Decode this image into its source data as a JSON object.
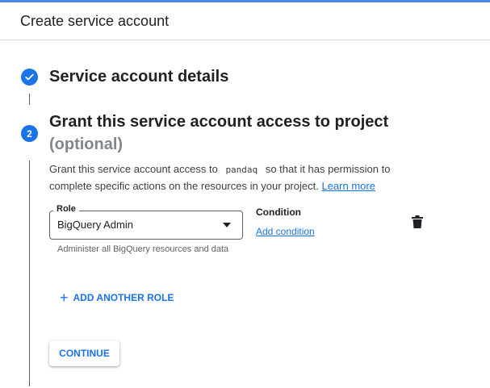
{
  "header": {
    "title": "Create service account"
  },
  "steps": [
    {
      "status": "completed",
      "title": "Service account details"
    },
    {
      "number": "2",
      "title": "Grant this service account access to project",
      "subtitle": "(optional)"
    }
  ],
  "grant": {
    "desc_prefix": "Grant this service account access to",
    "project_id": "pandaq",
    "desc_suffix": "so that it has permission to complete specific actions on the resources in your project.",
    "learn_more": "Learn more"
  },
  "role": {
    "label": "Role",
    "value": "BigQuery Admin",
    "hint": "Administer all BigQuery resources and data"
  },
  "condition": {
    "label": "Condition",
    "add_link": "Add condition"
  },
  "add_role_label": "ADD ANOTHER ROLE",
  "continue_label": "CONTINUE",
  "icons": {
    "step_done": "check-icon",
    "dropdown": "dropdown-arrow-icon",
    "delete": "trash-icon",
    "add": "plus-icon"
  },
  "colors": {
    "accent": "#1a73e8",
    "top_bar": "#4a86e8"
  }
}
